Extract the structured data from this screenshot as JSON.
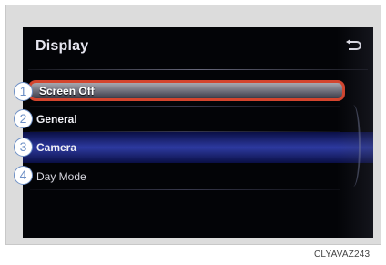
{
  "screen": {
    "title": "Display",
    "back_icon": "back-arrow-icon"
  },
  "menu": {
    "items": [
      {
        "label": "Screen Off",
        "state": "selected"
      },
      {
        "label": "General",
        "state": "normal"
      },
      {
        "label": "Camera",
        "state": "highlighted"
      },
      {
        "label": "Day Mode",
        "state": "normal"
      }
    ]
  },
  "callouts": [
    "1",
    "2",
    "3",
    "4"
  ],
  "figure_code": "CLYAVAZ243",
  "colors": {
    "selection_border": "#d4452e",
    "highlight": "#2d3aa0",
    "callout": "#6e90c6",
    "screen_bg": "#030407"
  }
}
